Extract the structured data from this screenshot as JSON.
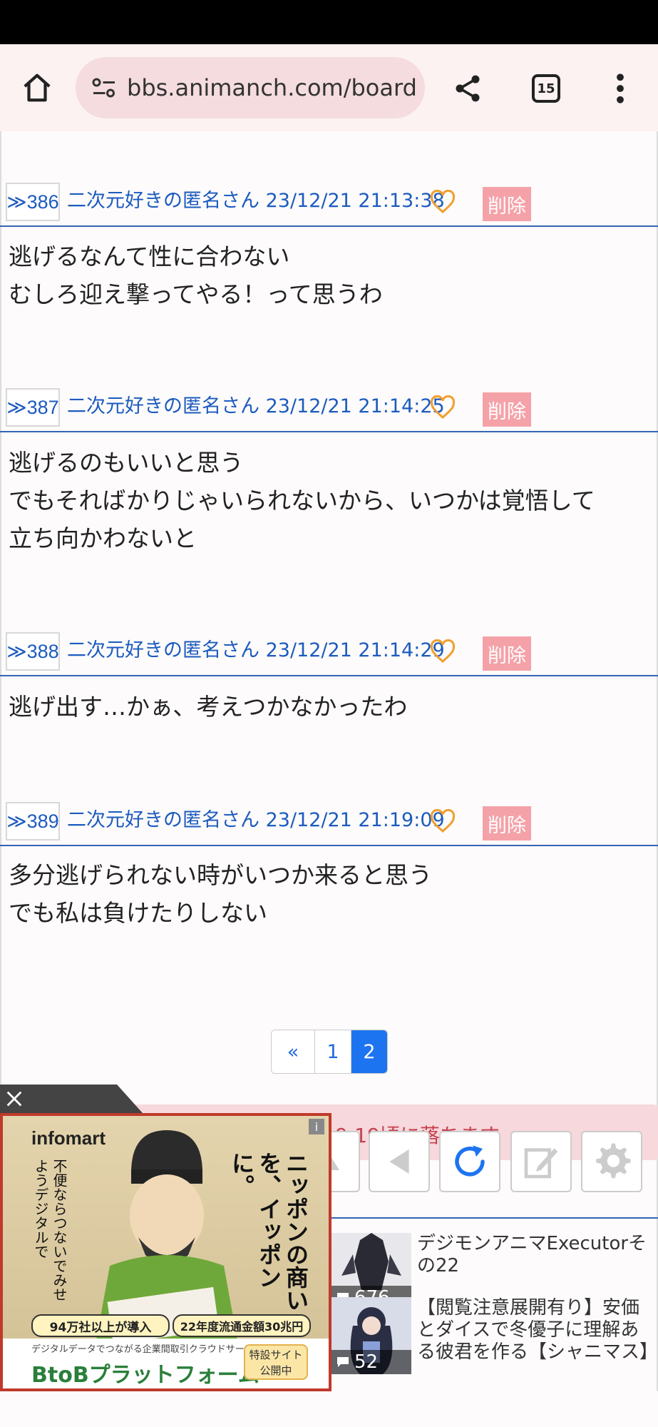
{
  "browser": {
    "url": "bbs.animanch.com/board",
    "tab_count": "15"
  },
  "posts": [
    {
      "num": "≫386",
      "meta": "二次元好きの匿名さん 23/12/21 21:13:38",
      "delete_label": "削除",
      "body": "逃げるなんて性に合わない\nむしろ迎え撃ってやる！って思うわ"
    },
    {
      "num": "≫387",
      "meta": "二次元好きの匿名さん 23/12/21 21:14:25",
      "delete_label": "削除",
      "body": "逃げるのもいいと思う\nでもそればかりじゃいられないから、いつかは覚悟して\n立ち向かわないと"
    },
    {
      "num": "≫388",
      "meta": "二次元好きの匿名さん 23/12/21 21:14:29",
      "delete_label": "削除",
      "body": "逃げ出す…かぁ、考えつかなかったわ"
    },
    {
      "num": "≫389",
      "meta": "二次元好きの匿名さん 23/12/21 21:19:09",
      "delete_label": "削除",
      "body": "多分逃げられない時がいつか来ると思う\nでも私は負けたりしない"
    }
  ],
  "pager": {
    "prev": "«",
    "pages": [
      "1",
      "2"
    ],
    "current": "2"
  },
  "notice": "9:19頃に落ちます",
  "related_threads": [
    {
      "count": "676",
      "title": "デジモンアニマExecutorその22"
    },
    {
      "count": "52",
      "title": "【閲覧注意展開有り】安価とダイスで冬優子に理解ある彼君を作る【シャニマス】"
    }
  ],
  "ad": {
    "brand": "infomart",
    "headline": "ニッポンの商いを、イッポンに。",
    "sub": "不便ならつないでみせようデジタルで",
    "stat1": "94万社以上が導入",
    "stat2": "22年度流通金額30兆円",
    "tagline": "デジタルデータでつながる企業間取引クラウドサービス",
    "platform": "BtoBプラットフォーム",
    "cta": "特設サイト公開中",
    "info_mark": "i"
  },
  "colors": {
    "link_blue": "#1c5bbf",
    "divider_blue": "#3564b4",
    "delete_pink": "#f4a2a8",
    "heart_orange": "#f0a030",
    "page_active": "#1d74f0"
  }
}
